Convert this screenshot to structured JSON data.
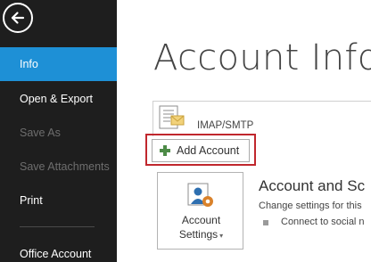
{
  "sidebar": {
    "items": [
      {
        "label": "Info"
      },
      {
        "label": "Open & Export"
      },
      {
        "label": "Save As"
      },
      {
        "label": "Save Attachments"
      },
      {
        "label": "Print"
      },
      {
        "label": "Office Account"
      }
    ]
  },
  "main": {
    "title": "Account Inform",
    "account_type": "IMAP/SMTP",
    "add_account_label": "Add Account",
    "settings_button": {
      "line1": "Account",
      "line2": "Settings"
    },
    "section_title": "Account and Sc",
    "section_desc": "Change settings for this",
    "bullet_text": "Connect to social n"
  },
  "colors": {
    "sidebar_bg": "#1e1e1e",
    "active_item": "#1e90d6",
    "highlight_box": "#c0272d",
    "plus_icon": "#4d8b47"
  }
}
